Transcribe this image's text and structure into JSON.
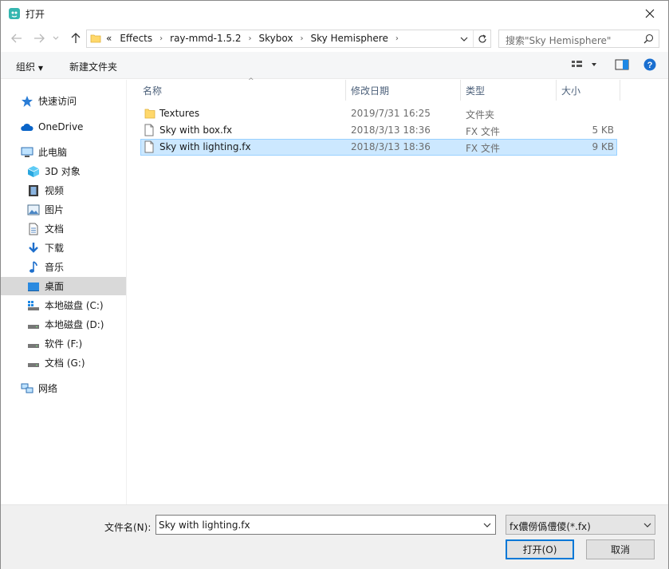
{
  "window": {
    "title": "打开"
  },
  "address": {
    "overflow": "«",
    "crumbs": [
      "Effects",
      "ray-mmd-1.5.2",
      "Skybox",
      "Sky Hemisphere"
    ],
    "search_placeholder": "搜索\"Sky Hemisphere\""
  },
  "toolbar": {
    "organize": "组织",
    "new_folder": "新建文件夹"
  },
  "nav": {
    "quick_access": "快速访问",
    "onedrive": "OneDrive",
    "this_pc": "此电脑",
    "objects3d": "3D 对象",
    "videos": "视频",
    "pictures": "图片",
    "documents": "文档",
    "downloads": "下载",
    "music": "音乐",
    "desktop": "桌面",
    "drive_c": "本地磁盘 (C:)",
    "drive_d": "本地磁盘 (D:)",
    "drive_f": "软件 (F:)",
    "drive_g": "文档 (G:)",
    "network": "网络"
  },
  "columns": {
    "name": "名称",
    "date": "修改日期",
    "type": "类型",
    "size": "大小"
  },
  "files": [
    {
      "name": "Textures",
      "date": "2019/7/31 16:25",
      "type": "文件夹",
      "size": ""
    },
    {
      "name": "Sky with box.fx",
      "date": "2018/3/13 18:36",
      "type": "FX 文件",
      "size": "5 KB"
    },
    {
      "name": "Sky with lighting.fx",
      "date": "2018/3/13 18:36",
      "type": "FX 文件",
      "size": "9 KB"
    }
  ],
  "bottom": {
    "filename_label": "文件名(N):",
    "filename_value": "Sky with lighting.fx",
    "filter_value": "fx儂僗僞僼儍(*.fx)",
    "open_label": "打开(O)",
    "cancel_label": "取消"
  },
  "colors": {
    "selection": "#cce8ff",
    "accent": "#0078d7",
    "nav_selected": "#d9d9d9"
  }
}
